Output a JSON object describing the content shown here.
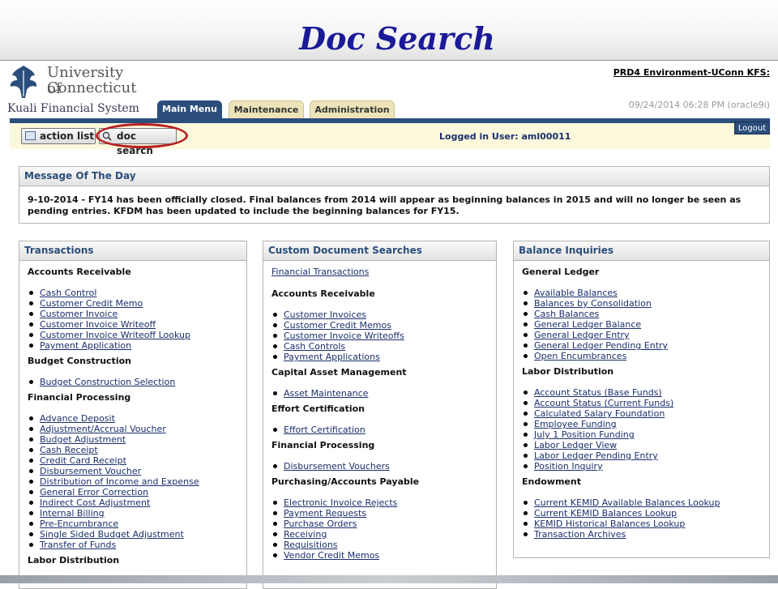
{
  "slide_title": "Doc Search",
  "logo": {
    "line1": "University of",
    "line2": "Connecticut",
    "line3": "Kuali Financial System"
  },
  "header": {
    "environment": "PRD4 Environment-UConn KFS:",
    "datetime": "09/24/2014 06:28 PM (oracle9i)"
  },
  "tabs": [
    {
      "label": "Main Menu",
      "active": true
    },
    {
      "label": "Maintenance",
      "active": false
    },
    {
      "label": "Administration",
      "active": false
    }
  ],
  "nav": {
    "action_list": "action list",
    "doc_search": "doc search",
    "logged_in": "Logged in User: aml00011",
    "logout": "Logout"
  },
  "motd": {
    "title": "Message Of The Day",
    "text": "9-10-2014 - FY14 has been officially closed. Final balances from 2014 will appear as beginning balances in 2015 and will no longer be seen as pending entries. KFDM has been updated to include the beginning balances for FY15."
  },
  "transactions": {
    "title": "Transactions",
    "sections": [
      {
        "heading": "Accounts Receivable",
        "items": [
          "Cash Control",
          "Customer Credit Memo",
          "Customer Invoice",
          "Customer Invoice Writeoff",
          "Customer Invoice Writeoff Lookup",
          "Payment Application"
        ]
      },
      {
        "heading": "Budget Construction",
        "items": [
          "Budget Construction Selection"
        ]
      },
      {
        "heading": "Financial Processing",
        "items": [
          "Advance Deposit",
          "Adjustment/Accrual Voucher",
          "Budget Adjustment",
          "Cash Receipt",
          "Credit Card Receipt",
          "Disbursement Voucher",
          "Distribution of Income and Expense",
          "General Error Correction",
          "Indirect Cost Adjustment",
          "Internal Billing",
          "Pre-Encumbrance",
          "Single Sided Budget Adjustment",
          "Transfer of Funds"
        ]
      },
      {
        "heading": "Labor Distribution",
        "items": []
      }
    ]
  },
  "custom_searches": {
    "title": "Custom Document Searches",
    "top_link": "Financial Transactions",
    "sections": [
      {
        "heading": "Accounts Receivable",
        "items": [
          "Customer Invoices",
          "Customer Credit Memos",
          "Customer Invoice Writeoffs",
          "Cash Controls",
          "Payment Applications"
        ]
      },
      {
        "heading": "Capital Asset Management",
        "items": [
          "Asset Maintenance"
        ]
      },
      {
        "heading": "Effort Certification",
        "items": [
          "Effort Certification"
        ]
      },
      {
        "heading": "Financial Processing",
        "items": [
          "Disbursement Vouchers"
        ]
      },
      {
        "heading": "Purchasing/Accounts Payable",
        "items": [
          "Electronic Invoice Rejects",
          "Payment Requests",
          "Purchase Orders",
          "Receiving",
          "Requisitions",
          "Vendor Credit Memos"
        ]
      }
    ]
  },
  "balance_inquiries": {
    "title": "Balance Inquiries",
    "sections": [
      {
        "heading": "General Ledger",
        "items": [
          "Available Balances",
          "Balances by Consolidation",
          "Cash Balances",
          "General Ledger Balance",
          "General Ledger Entry",
          "General Ledger Pending Entry",
          "Open Encumbrances"
        ]
      },
      {
        "heading": "Labor Distribution",
        "items": [
          "Account Status (Base Funds)",
          "Account Status (Current Funds)",
          "Calculated Salary Foundation",
          "Employee Funding",
          "July 1 Position Funding",
          "Labor Ledger View",
          "Labor Ledger Pending Entry",
          "Position Inquiry"
        ]
      },
      {
        "heading": "Endowment",
        "items": [
          "Current KEMID Available Balances Lookup",
          "Current KEMID Balances Lookup",
          "KEMID Historical Balances Lookup",
          "Transaction Archives"
        ]
      }
    ]
  },
  "colors": {
    "tab_active": "#2b4e7c",
    "link": "#1b2f6b",
    "title": "#1a1a99",
    "highlight": "#b81f22"
  }
}
